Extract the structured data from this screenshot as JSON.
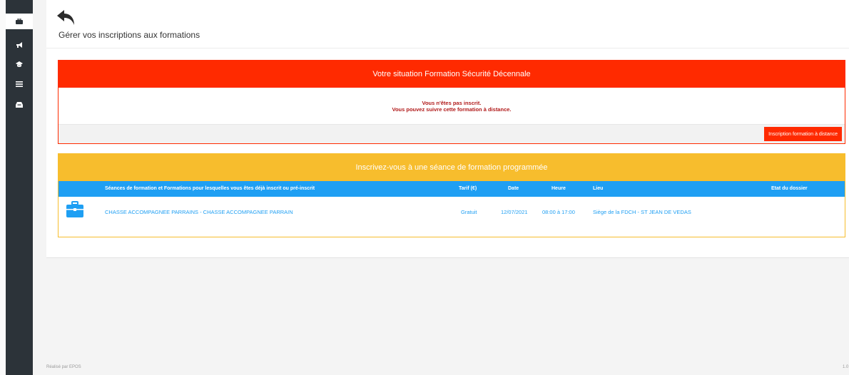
{
  "sidebar": {
    "items": [
      {
        "icon": "briefcase-icon"
      },
      {
        "icon": "megaphone-icon"
      },
      {
        "icon": "graduation-cap-icon"
      },
      {
        "icon": "list-icon"
      },
      {
        "icon": "inbox-icon"
      }
    ]
  },
  "header": {
    "title": "Gérer vos inscriptions aux formations"
  },
  "situation": {
    "title": "Votre situation Formation Sécurité Décennale",
    "message_line1": "Vous n'êtes pas inscrit.",
    "message_line2": "Vous pouvez suivre cette formation à distance.",
    "button_label": "Inscription formation à distance"
  },
  "sessions": {
    "title": "Inscrivez-vous à une séance de formation programmée",
    "columns": {
      "seances": "Séances de formation et Formations pour lesquelles vous êtes déjà inscrit ou pré-inscrit",
      "tarif": "Tarif (€)",
      "date": "Date",
      "heure": "Heure",
      "lieu": "Lieu",
      "etat": "Etat du dossier"
    },
    "rows": [
      {
        "name": "CHASSE ACCOMPAGNEE PARRAINS - CHASSE ACCOMPAGNEE PARRAIN",
        "tarif": "Gratuit",
        "date": "12/07/2021",
        "heure": "08:00 à 17:00",
        "lieu": "Siège de la FDCH - ST JEAN DE VEDAS",
        "etat": ""
      }
    ]
  },
  "footer": {
    "credit": "Réalisé par EPOS",
    "version": "1.0"
  },
  "colors": {
    "sidebar": "#2c3339",
    "alert_red": "#ff2a00",
    "session_orange": "#f7bd2d",
    "table_blue": "#1f9ff3"
  }
}
